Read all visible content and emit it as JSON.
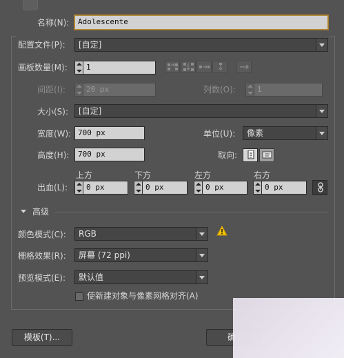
{
  "name": {
    "label": "名称(N):",
    "value": "Adolescente"
  },
  "profile": {
    "label": "配置文件(P):",
    "value": "[自定]"
  },
  "artboards": {
    "label": "画板数量(M):",
    "value": "1"
  },
  "spacing": {
    "label": "间距(I):",
    "value": "20 px"
  },
  "columns": {
    "label": "列数(O):",
    "value": "1"
  },
  "size": {
    "label": "大小(S):",
    "value": "[自定]"
  },
  "width": {
    "label": "宽度(W):",
    "value": "700 px"
  },
  "units": {
    "label": "单位(U):",
    "value": "像素"
  },
  "height": {
    "label": "高度(H):",
    "value": "700 px"
  },
  "orientation": {
    "label": "取向:"
  },
  "bleed": {
    "label": "出血(L):",
    "top": {
      "label": "上方",
      "value": "0 px"
    },
    "bottom": {
      "label": "下方",
      "value": "0 px"
    },
    "left": {
      "label": "左方",
      "value": "0 px"
    },
    "right": {
      "label": "右方",
      "value": "0 px"
    }
  },
  "advanced": {
    "label": "高级"
  },
  "color_mode": {
    "label": "颜色模式(C):",
    "value": "RGB"
  },
  "raster": {
    "label": "栅格效果(R):",
    "value": "屏幕 (72 ppi)"
  },
  "preview": {
    "label": "预览模式(E):",
    "value": "默认值"
  },
  "align_pixel": {
    "label": "使新建对象与像素网格对齐(A)",
    "checked": false
  },
  "buttons": {
    "templates": "模板(T)...",
    "ok": "确"
  },
  "colors": {
    "background": "#535353",
    "warning": "#f5c400",
    "field_bg": "#d2d2d2"
  }
}
